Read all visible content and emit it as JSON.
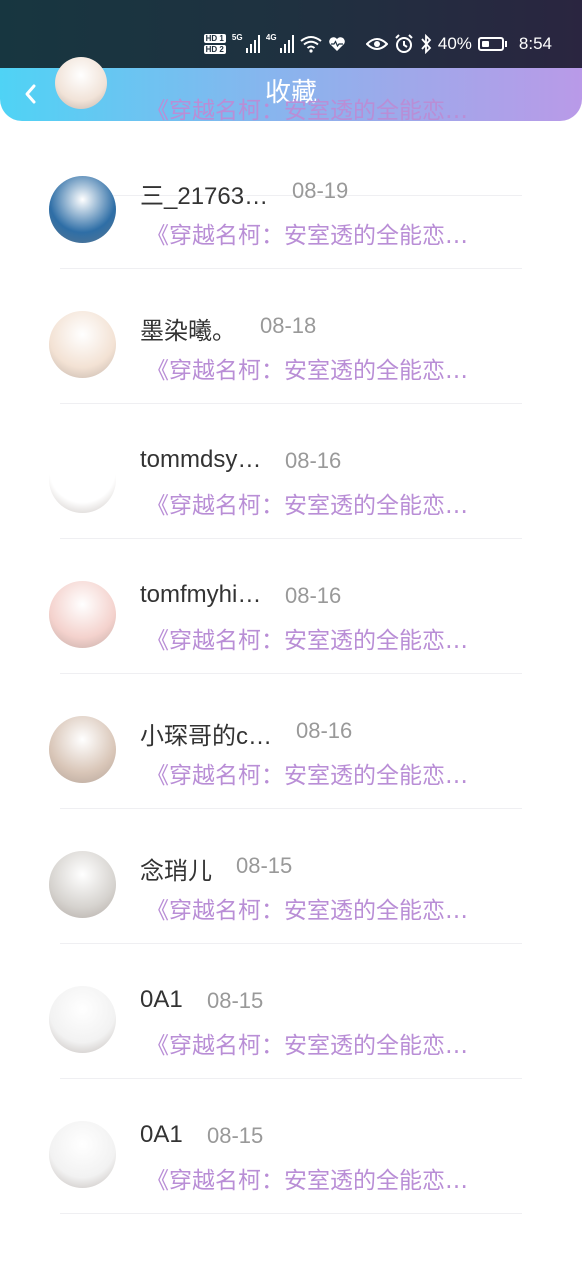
{
  "status_bar": {
    "sim1": "HD 1",
    "sim2": "HD 2",
    "net1": "5G",
    "net2": "4G",
    "battery_percent": "40%",
    "battery_level": 0.4,
    "time": "8:54",
    "icons": [
      "signal-5g-icon",
      "signal-4g-icon",
      "wifi-icon",
      "heart-icon",
      "eye-icon",
      "alarm-icon",
      "bluetooth-icon",
      "battery-icon"
    ]
  },
  "header": {
    "back_icon": "chevron-left-icon",
    "title": "收藏",
    "gradient": [
      "#4fd3f5",
      "#b99ae8"
    ]
  },
  "book_color": "#b98ed6",
  "items": [
    {
      "name": "",
      "date": "",
      "book": "《穿越名柯：安室透的全能恋…",
      "avatar_color": "#f1e3d8"
    },
    {
      "name": "三_21763…",
      "date": "08-19",
      "book": "《穿越名柯：安室透的全能恋…",
      "avatar_color": "#2e6ea6"
    },
    {
      "name": "墨染曦。",
      "date": "08-18",
      "book": "《穿越名柯：安室透的全能恋…",
      "avatar_color": "#f3e2d4"
    },
    {
      "name": "tommdsy…",
      "date": "08-16",
      "book": "《穿越名柯：安室透的全能恋…",
      "avatar_color": "#ffffff"
    },
    {
      "name": "tomfmyhi…",
      "date": "08-16",
      "book": "《穿越名柯：安室透的全能恋…",
      "avatar_color": "#f4d2cd"
    },
    {
      "name": "小琛哥的c…",
      "date": "08-16",
      "book": "《穿越名柯：安室透的全能恋…",
      "avatar_color": "#d9c6b8"
    },
    {
      "name": "念琑儿",
      "date": "08-15",
      "book": "《穿越名柯：安室透的全能恋…",
      "avatar_color": "#d6d3cf"
    },
    {
      "name": "0A1",
      "date": "08-15",
      "book": "《穿越名柯：安室透的全能恋…",
      "avatar_color": "#f2f2f2"
    },
    {
      "name": "0A1",
      "date": "08-15",
      "book": "《穿越名柯：安室透的全能恋…",
      "avatar_color": "#f2f2f2"
    }
  ]
}
